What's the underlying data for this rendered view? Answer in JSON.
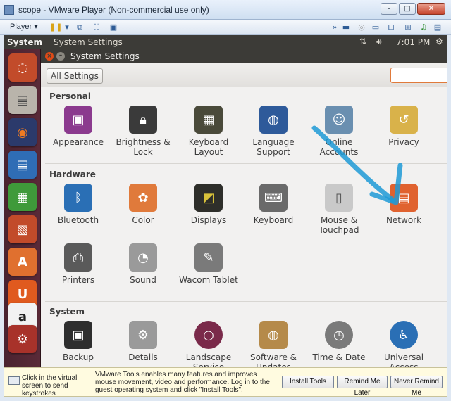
{
  "window": {
    "title": "scope - VMware Player (Non-commercial use only)"
  },
  "vm_toolbar": {
    "player_menu": "Player"
  },
  "ubuntu_panel": {
    "app_name": "System",
    "window_name": "System Settings",
    "clock": "7:01 PM"
  },
  "settings": {
    "title": "System Settings",
    "all_settings_label": "All Settings",
    "search_value": "",
    "sections": [
      {
        "title": "Personal",
        "items": [
          {
            "label": "Appearance",
            "icon": "appearance-icon",
            "color": "#8b3a8e"
          },
          {
            "label": "Brightness & Lock",
            "icon": "brightness-lock-icon",
            "color": "#3a3a3a"
          },
          {
            "label": "Keyboard Layout",
            "icon": "keyboard-layout-icon",
            "color": "#4a4a3a"
          },
          {
            "label": "Language Support",
            "icon": "language-support-icon",
            "color": "#2e5a9a"
          },
          {
            "label": "Online Accounts",
            "icon": "online-accounts-icon",
            "color": "#6a8fb0"
          },
          {
            "label": "Privacy",
            "icon": "privacy-icon",
            "color": "#d9b24a"
          }
        ]
      },
      {
        "title": "Hardware",
        "items": [
          {
            "label": "Bluetooth",
            "icon": "bluetooth-icon",
            "color": "#2a6fb5"
          },
          {
            "label": "Color",
            "icon": "color-icon",
            "color": "#e07a3b"
          },
          {
            "label": "Displays",
            "icon": "displays-icon",
            "color": "#2e2e2a"
          },
          {
            "label": "Keyboard",
            "icon": "keyboard-icon",
            "color": "#6a6a6a"
          },
          {
            "label": "Mouse & Touchpad",
            "icon": "mouse-touchpad-icon",
            "color": "#c9c9c9"
          },
          {
            "label": "Network",
            "icon": "network-icon",
            "color": "#e0622f"
          },
          {
            "label": "Printers",
            "icon": "printers-icon",
            "color": "#5a5a5a"
          },
          {
            "label": "Sound",
            "icon": "sound-icon",
            "color": "#9a9a9a"
          },
          {
            "label": "Wacom Tablet",
            "icon": "wacom-tablet-icon",
            "color": "#7a7a7a"
          }
        ]
      },
      {
        "title": "System",
        "items": [
          {
            "label": "Backup",
            "icon": "backup-icon",
            "color": "#2e2e2e"
          },
          {
            "label": "Details",
            "icon": "details-icon",
            "color": "#9a9a9a"
          },
          {
            "label": "Landscape Service",
            "icon": "landscape-service-icon",
            "color": "#7a2a4a"
          },
          {
            "label": "Software & Updates",
            "icon": "software-updates-icon",
            "color": "#b58a4a"
          },
          {
            "label": "Time & Date",
            "icon": "time-date-icon",
            "color": "#7a7a7a"
          },
          {
            "label": "Universal Access",
            "icon": "universal-access-icon",
            "color": "#2a6fb5"
          }
        ]
      }
    ]
  },
  "tools_bar": {
    "hint": "Click in the virtual screen to send keystrokes",
    "message": "VMware Tools enables many features and improves mouse movement, video and performance. Log in to the guest operating system and click \"Install Tools\".",
    "install_label": "Install Tools",
    "remind_label": "Remind Me Later",
    "never_label": "Never Remind Me"
  },
  "colors": {
    "accent_orange": "#e07a3b",
    "panel_dark": "#3c3b37",
    "arrow_blue": "#1e9ad6"
  }
}
